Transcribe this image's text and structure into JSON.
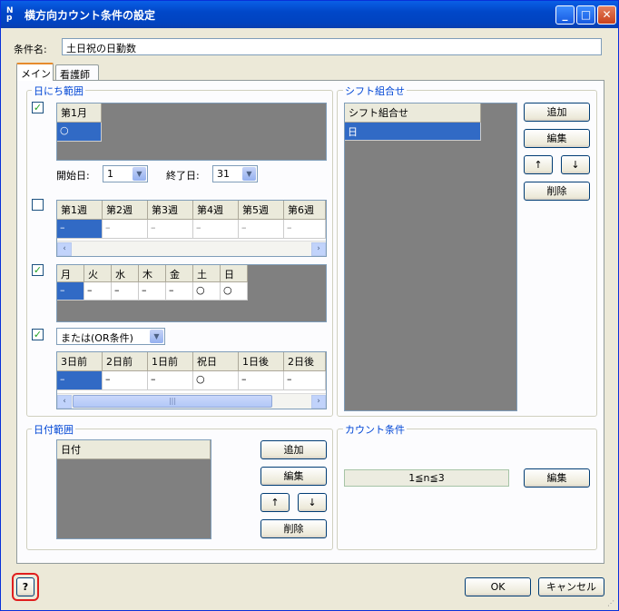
{
  "window": {
    "title": "横方向カウント条件の設定",
    "app_icon_text": "N p"
  },
  "condition_name": {
    "label": "条件名:",
    "value": "土日祝の日勤数"
  },
  "tabs": [
    {
      "label": "メイン"
    },
    {
      "label": "看護師"
    }
  ],
  "date_range": {
    "title": "日にち範囲",
    "month": {
      "header": "第1月",
      "value": "○"
    },
    "start_label": "開始日:",
    "start_value": "1",
    "end_label": "終了日:",
    "end_value": "31",
    "weeks": {
      "headers": [
        "第1週",
        "第2週",
        "第3週",
        "第4週",
        "第5週",
        "第6週"
      ],
      "values": [
        "–",
        "–",
        "–",
        "–",
        "–",
        "–"
      ]
    },
    "weekdays": {
      "headers": [
        "月",
        "火",
        "水",
        "木",
        "金",
        "土",
        "日"
      ],
      "values": [
        "–",
        "–",
        "–",
        "–",
        "–",
        "○",
        "○"
      ]
    },
    "or_condition": "または(OR条件)",
    "relative": {
      "headers": [
        "3日前",
        "2日前",
        "1日前",
        "祝日",
        "1日後",
        "2日後"
      ],
      "values": [
        "–",
        "–",
        "–",
        "○",
        "–",
        "–"
      ]
    }
  },
  "shift_combo": {
    "title": "シフト組合せ",
    "header": "シフト組合せ",
    "rows": [
      "日"
    ],
    "buttons": {
      "add": "追加",
      "edit": "編集",
      "up": "↑",
      "down": "↓",
      "delete": "削除"
    }
  },
  "dates_range": {
    "title": "日付範囲",
    "header": "日付",
    "buttons": {
      "add": "追加",
      "edit": "編集",
      "up": "↑",
      "down": "↓",
      "delete": "削除"
    }
  },
  "count_condition": {
    "title": "カウント条件",
    "value": "1≦n≦3",
    "edit": "編集"
  },
  "footer": {
    "help": "?",
    "ok": "OK",
    "cancel": "キャンセル"
  },
  "colors": {
    "titlebar": "#0147c8",
    "selection": "#316ac5",
    "group_title": "#0046d5",
    "help_highlight": "#e01e1e"
  }
}
